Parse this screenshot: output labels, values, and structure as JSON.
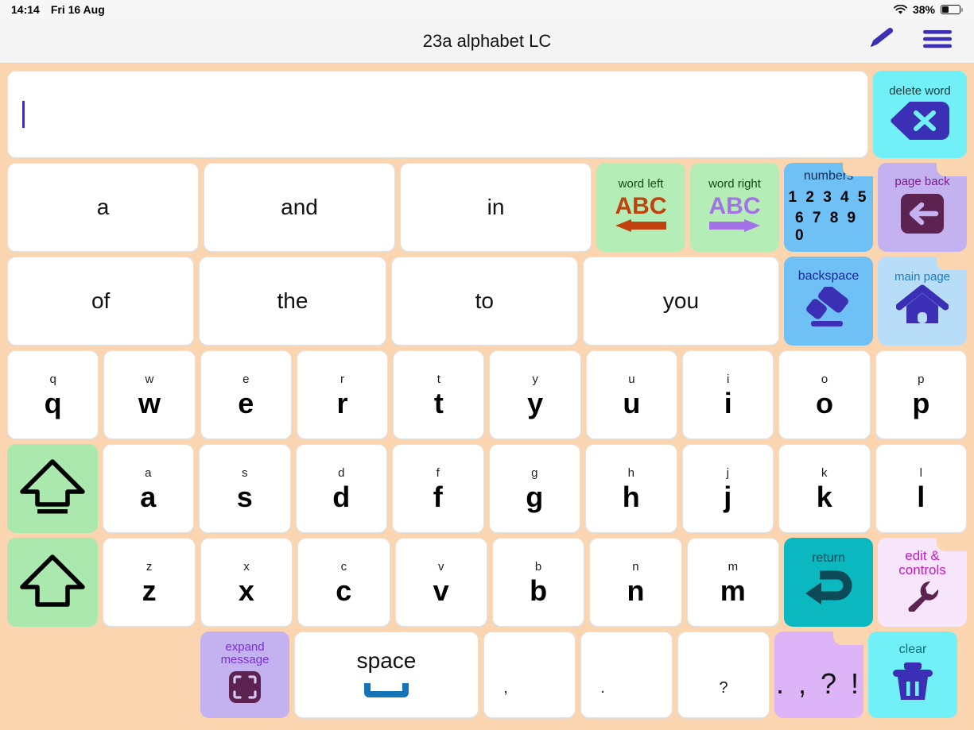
{
  "status_bar": {
    "time": "14:14",
    "date": "Fri 16 Aug",
    "battery_percent": "38%",
    "wifi_icon": "wifi-icon",
    "battery_icon": "battery-icon",
    "battery_level": 38
  },
  "header": {
    "title": "23a alphabet LC",
    "edit_icon": "pencil-icon",
    "menu_icon": "hamburger-menu-icon"
  },
  "message": {
    "text": "",
    "caret_color": "#3b2fb5"
  },
  "delete_word": {
    "label": "delete word",
    "icon": "backspace-x-icon",
    "bg": "#71f0f7",
    "icon_color": "#3b2fb5"
  },
  "prediction_row_1": [
    {
      "label": "a"
    },
    {
      "label": "and"
    },
    {
      "label": "in"
    }
  ],
  "prediction_row_2": [
    {
      "label": "of"
    },
    {
      "label": "the"
    },
    {
      "label": "to"
    },
    {
      "label": "you"
    }
  ],
  "nav_buttons": {
    "word_left": {
      "label": "word left",
      "glyph": "ABC",
      "icon": "arrow-left-icon",
      "bg": "#b4edb6",
      "accent": "#c2410c"
    },
    "word_right": {
      "label": "word right",
      "glyph": "ABC",
      "icon": "arrow-right-icon",
      "bg": "#b4edb6",
      "accent": "#a571e8"
    },
    "numbers": {
      "label": "numbers",
      "line1": "1 2 3 4 5",
      "line2": "6 7 8 9 0",
      "bg": "#6ec0f5"
    },
    "page_back": {
      "label": "page back",
      "icon": "arrow-left-icon",
      "bg": "#c3b1f0",
      "badge_bg": "#5c2250",
      "text_color": "#7a1f8e"
    },
    "backspace": {
      "label": "backspace",
      "icon": "eraser-icon",
      "bg": "#6ec0f5",
      "text_color": "#1e1ea0",
      "icon_color": "#3b2fb5"
    },
    "main_page": {
      "label": "main page",
      "icon": "home-icon",
      "bg": "#b8ddf8",
      "text_color": "#1e7ab8",
      "icon_color": "#3b2fb5"
    }
  },
  "keyboard_rows": [
    {
      "keys": [
        {
          "small": "q",
          "big": "q"
        },
        {
          "small": "w",
          "big": "w"
        },
        {
          "small": "e",
          "big": "e"
        },
        {
          "small": "r",
          "big": "r"
        },
        {
          "small": "t",
          "big": "t"
        },
        {
          "small": "y",
          "big": "y"
        },
        {
          "small": "u",
          "big": "u"
        },
        {
          "small": "i",
          "big": "i"
        },
        {
          "small": "o",
          "big": "o"
        },
        {
          "small": "p",
          "big": "p"
        }
      ]
    },
    {
      "leading": {
        "name": "caps-lock-key",
        "icon": "caps-lock-arrow-icon",
        "bg": "#aae8ae"
      },
      "keys": [
        {
          "small": "a",
          "big": "a"
        },
        {
          "small": "s",
          "big": "s"
        },
        {
          "small": "d",
          "big": "d"
        },
        {
          "small": "f",
          "big": "f"
        },
        {
          "small": "g",
          "big": "g"
        },
        {
          "small": "h",
          "big": "h"
        },
        {
          "small": "j",
          "big": "j"
        },
        {
          "small": "k",
          "big": "k"
        },
        {
          "small": "l",
          "big": "l"
        }
      ]
    },
    {
      "leading": {
        "name": "shift-key",
        "icon": "shift-arrow-icon",
        "bg": "#aae8ae"
      },
      "keys": [
        {
          "small": "z",
          "big": "z"
        },
        {
          "small": "x",
          "big": "x"
        },
        {
          "small": "c",
          "big": "c"
        },
        {
          "small": "v",
          "big": "v"
        },
        {
          "small": "b",
          "big": "b"
        },
        {
          "small": "n",
          "big": "n"
        },
        {
          "small": "m",
          "big": "m"
        }
      ]
    }
  ],
  "right_column": {
    "return": {
      "label": "return",
      "icon": "return-arrow-icon",
      "bg": "#0bb8bf",
      "text_color": "#0b4a56",
      "icon_color": "#0b4a56"
    },
    "edit_controls": {
      "label_line1": "edit &",
      "label_line2": "controls",
      "icon": "wrench-icon",
      "bg": "#f7e6fb",
      "text_color": "#c318c3",
      "icon_color": "#5c2250"
    }
  },
  "bottom_row": {
    "expand_message": {
      "label_line1": "expand",
      "label_line2": "message",
      "icon": "expand-icon",
      "bg": "#c3b1f0",
      "text_color": "#7a2fd6",
      "icon_color": "#5c2250"
    },
    "space": {
      "label": "space",
      "icon": "spacebar-icon",
      "icon_color": "#1574b8"
    },
    "comma": {
      "label": ","
    },
    "period": {
      "label": "."
    },
    "question": {
      "label": "?"
    },
    "punctuation_folder": {
      "label": ". , ? !",
      "bg": "#ddb4f7"
    },
    "clear": {
      "label": "clear",
      "icon": "trash-icon",
      "bg": "#71f0f7",
      "text_color": "#106b6e",
      "icon_color": "#3b2fb5"
    }
  }
}
